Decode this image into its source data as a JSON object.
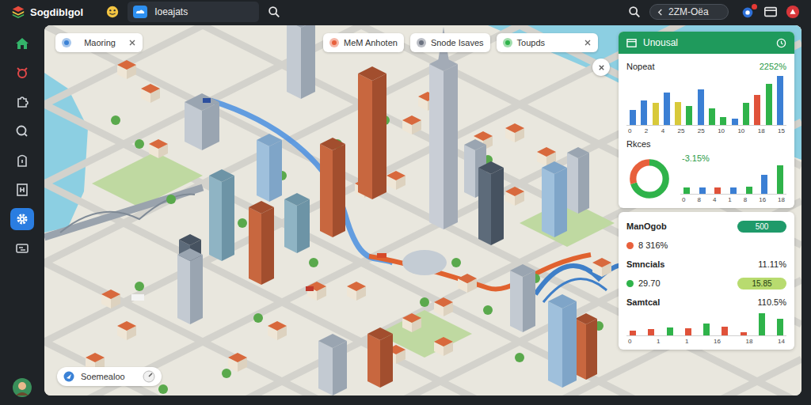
{
  "app": {
    "title": "Sogdiblgol"
  },
  "top_tabs": [
    {
      "label": "Ioeajats",
      "selected": true
    }
  ],
  "top_search": {
    "value": "2ZM-Oëa"
  },
  "notifications": {
    "unread": true
  },
  "sidebar": {
    "items": [
      {
        "selected": false
      },
      {
        "selected": false
      },
      {
        "selected": false
      },
      {
        "selected": false
      },
      {
        "selected": false
      },
      {
        "selected": false
      },
      {
        "selected": true
      },
      {
        "selected": false
      }
    ]
  },
  "map_chips": [
    {
      "label": "Maoring",
      "closable": true,
      "color": "#3b82d6"
    },
    {
      "label": "MeM Anhoten",
      "closable": false,
      "color": "#e8603c"
    },
    {
      "label": "Snode Isaves",
      "closable": false,
      "color": "#6b7280"
    },
    {
      "label": "Toupds",
      "closable": true,
      "color": "#2fb34a"
    }
  ],
  "bottom_chip": {
    "label": "Soemealoo"
  },
  "panel": {
    "title": "Unousal",
    "metric": {
      "label": "Nopeat",
      "value": "2252%"
    },
    "bar_chart": {
      "bars": [
        {
          "value": 28,
          "color": "#3b7fd4"
        },
        {
          "value": 45,
          "color": "#3b7fd4"
        },
        {
          "value": 40,
          "color": "#d8c93a"
        },
        {
          "value": 60,
          "color": "#3b7fd4"
        },
        {
          "value": 42,
          "color": "#d8c93a"
        },
        {
          "value": 35,
          "color": "#2fb34a"
        },
        {
          "value": 65,
          "color": "#3b7fd4"
        },
        {
          "value": 30,
          "color": "#2fb34a"
        },
        {
          "value": 15,
          "color": "#2fb34a"
        },
        {
          "value": 12,
          "color": "#3b7fd4"
        },
        {
          "value": 40,
          "color": "#2fb34a"
        },
        {
          "value": 55,
          "color": "#e0523a"
        },
        {
          "value": 75,
          "color": "#2fb34a"
        },
        {
          "value": 90,
          "color": "#3b7fd4"
        }
      ],
      "x_ticks": [
        "0",
        "2",
        "4",
        "25",
        "25",
        "10",
        "10",
        "18",
        "15"
      ]
    },
    "donut_section": {
      "label": "Rkces",
      "change": "-3.15%",
      "segments": [
        {
          "value": 70,
          "color": "#2fb34a"
        },
        {
          "value": 30,
          "color": "#e8603c"
        }
      ],
      "bar_chart": {
        "bars": [
          {
            "value": 20,
            "color": "#2fb34a"
          },
          {
            "value": 20,
            "color": "#3b7fd4"
          },
          {
            "value": 20,
            "color": "#e0523a"
          },
          {
            "value": 20,
            "color": "#3b7fd4"
          },
          {
            "value": 22,
            "color": "#2fb34a"
          },
          {
            "value": 60,
            "color": "#3b7fd4"
          },
          {
            "value": 90,
            "color": "#2fb34a"
          }
        ],
        "x_ticks": [
          "0",
          "8",
          "4",
          "1",
          "8",
          "16",
          "18"
        ]
      }
    }
  },
  "summary": {
    "rows": [
      {
        "kind": "pill",
        "label": "ManOgob",
        "value": "500",
        "pill_color": "#1f9a6a"
      },
      {
        "kind": "dot",
        "label": "8 316%",
        "dot_color": "#e8603c"
      },
      {
        "kind": "text",
        "label": "Smncials",
        "value": "11.11%"
      },
      {
        "kind": "dot-pill",
        "label": "29.70",
        "value": "15.85",
        "dot_color": "#2fb34a",
        "pill_color": "#b8db6f"
      },
      {
        "kind": "text",
        "label": "Samtcal",
        "value": "110.5%"
      }
    ],
    "bar_chart": {
      "bars": [
        {
          "value": 15,
          "color": "#e0523a"
        },
        {
          "value": 22,
          "color": "#e0523a"
        },
        {
          "value": 28,
          "color": "#2fb34a"
        },
        {
          "value": 25,
          "color": "#e0523a"
        },
        {
          "value": 40,
          "color": "#2fb34a"
        },
        {
          "value": 30,
          "color": "#e0523a"
        },
        {
          "value": 12,
          "color": "#e0523a"
        },
        {
          "value": 75,
          "color": "#2fb34a"
        },
        {
          "value": 55,
          "color": "#2fb34a"
        }
      ],
      "x_ticks": [
        "0",
        "1",
        "1",
        "16",
        "18",
        "14"
      ]
    }
  }
}
